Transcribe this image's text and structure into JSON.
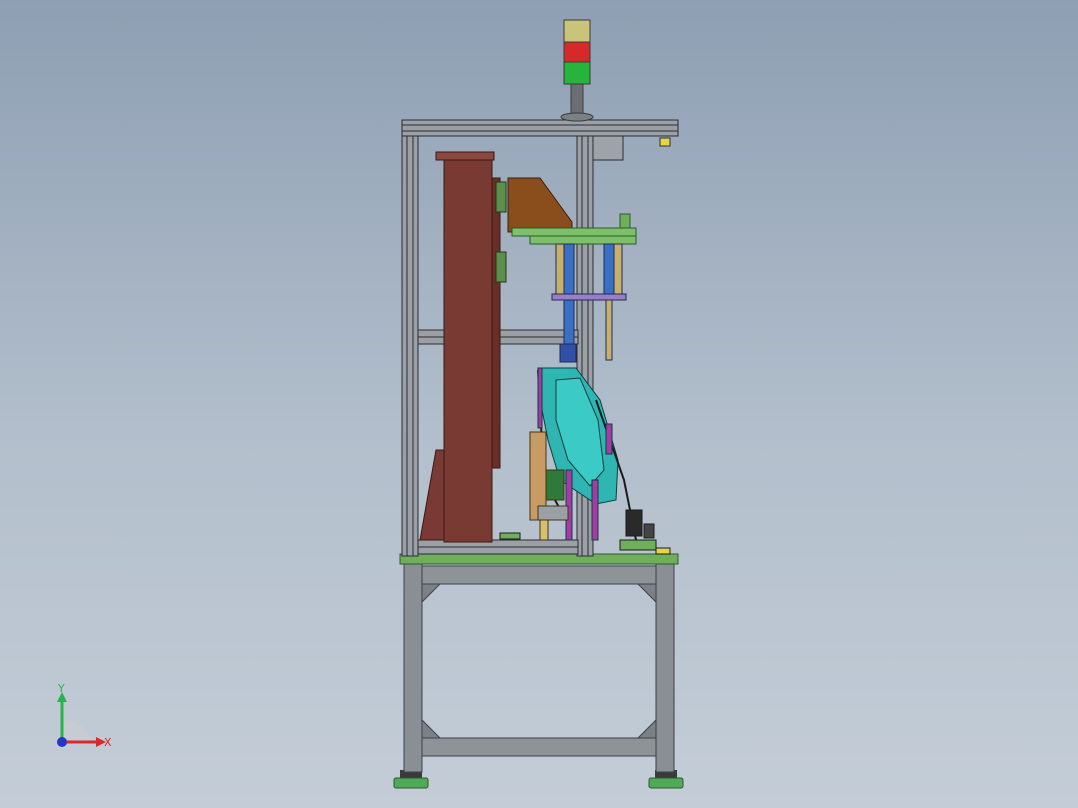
{
  "viewport": {
    "background_top": "#8e9fb3",
    "background_bottom": "#c4cdd7"
  },
  "triad": {
    "x_label": "X",
    "y_label": "Y",
    "x_color": "#e0252a",
    "y_color": "#2ab34a",
    "z_color": "#2436c8"
  },
  "model": {
    "frame_color": "#8a8f95",
    "table_top_color": "#6fae5a",
    "cabinet_color": "#7a3a34",
    "bracket_color": "#8a4e1c",
    "fixture_color": "#2fb5b2",
    "cylinder_color": "#3a6fc4",
    "stack_light": [
      "#c9c47a",
      "#d62a2a",
      "#27b43c"
    ]
  }
}
